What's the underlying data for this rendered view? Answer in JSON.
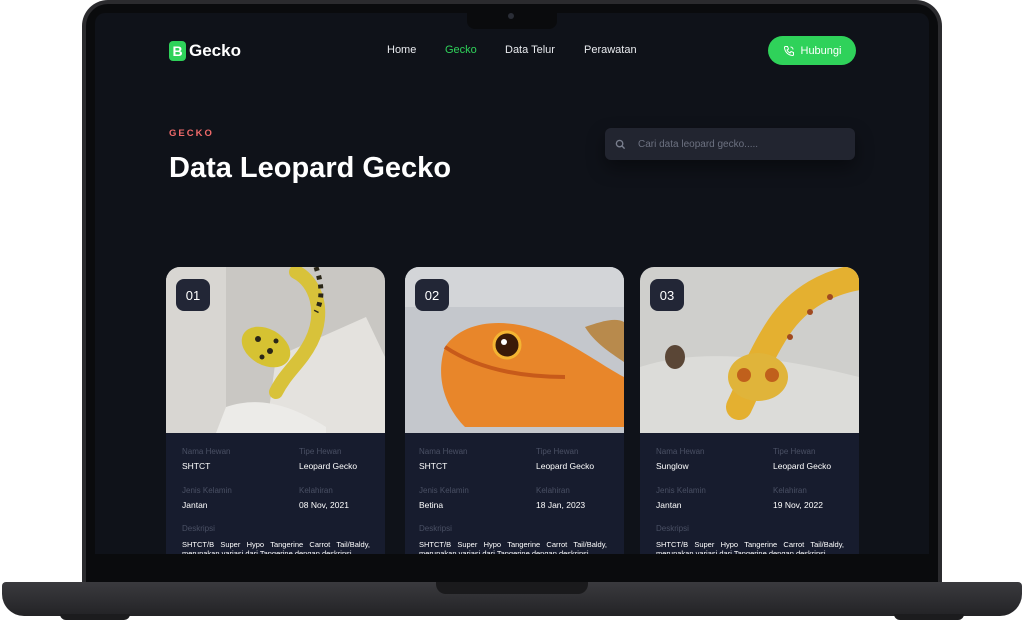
{
  "brand": {
    "mark": "B",
    "name": "Gecko"
  },
  "nav": {
    "items": [
      "Home",
      "Gecko",
      "Data Telur",
      "Perawatan"
    ],
    "active": "Gecko"
  },
  "contact_button": {
    "label": "Hubungi",
    "icon": "phone-icon"
  },
  "hero": {
    "eyebrow": "GECKO",
    "title": "Data Leopard Gecko"
  },
  "search": {
    "placeholder": "Cari data leopard gecko.....",
    "icon": "search-icon"
  },
  "field_labels": {
    "name": "Nama Hewan",
    "type": "Tipe Hewan",
    "gender": "Jenis Kelamin",
    "birth": "Kelahiran",
    "description": "Deskripsi"
  },
  "cards": [
    {
      "number": "01",
      "name": "SHTCT",
      "type": "Leopard Gecko",
      "gender": "Jantan",
      "birth": "08 Nov, 2021",
      "description": "SHTCT/B Super Hypo Tangerine Carrot Tail/Baldy, merupakan variasi dari Tangerine dengan deskripsi"
    },
    {
      "number": "02",
      "name": "SHTCT",
      "type": "Leopard Gecko",
      "gender": "Betina",
      "birth": "18 Jan, 2023",
      "description": "SHTCT/B Super Hypo Tangerine Carrot Tail/Baldy, merupakan variasi dari Tangerine dengan deskripsi"
    },
    {
      "number": "03",
      "name": "Sunglow",
      "type": "Leopard Gecko",
      "gender": "Jantan",
      "birth": "19 Nov, 2022",
      "description": "SHTCT/B Super Hypo Tangerine Carrot Tail/Baldy, merupakan variasi dari Tangerine dengan deskripsi"
    }
  ],
  "colors": {
    "accent": "#2fd25a",
    "eyebrow": "#f06a6a",
    "background": "#0f1219",
    "card": "#171c2e"
  }
}
